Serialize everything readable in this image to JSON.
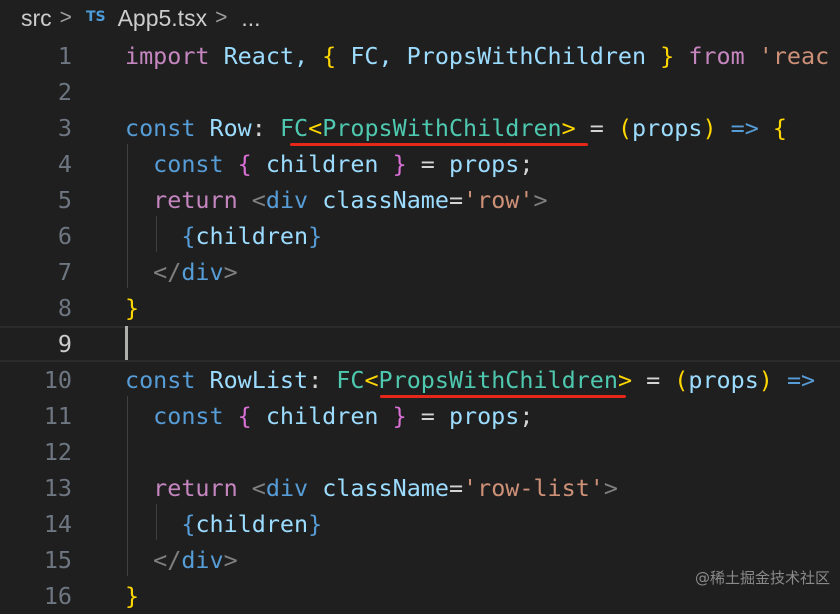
{
  "breadcrumb": {
    "folder": "src",
    "separator": ">",
    "file_badge": "TS",
    "file": "App5.tsx",
    "ellipsis": "..."
  },
  "colors": {
    "keyword": "#569cd6",
    "control": "#c586c0",
    "type": "#4ec9b0",
    "variable": "#9cdcfe",
    "function": "#dcdcaa",
    "string": "#ce9178",
    "bracket_gold": "#ffd700",
    "bracket_pink": "#da70d6",
    "bracket_blue": "#179fff",
    "tag": "#808080",
    "plain": "#d4d4d4",
    "underline": "#e8271b"
  },
  "editor": {
    "current_line": 9,
    "lines": [
      {
        "n": "1",
        "tokens": [
          [
            "import",
            "control"
          ],
          [
            " React, ",
            "variable"
          ],
          [
            "{",
            "bracket_gold"
          ],
          [
            " FC, PropsWithChildren ",
            "variable"
          ],
          [
            "}",
            "bracket_gold"
          ],
          [
            " from ",
            "control"
          ],
          [
            "'reac",
            "string"
          ]
        ]
      },
      {
        "n": "2",
        "tokens": []
      },
      {
        "n": "3",
        "tokens": [
          [
            "const",
            "keyword"
          ],
          [
            " Row",
            "variable"
          ],
          [
            ": ",
            "plain"
          ],
          [
            "FC",
            "type"
          ],
          [
            "<",
            "bracket_gold"
          ],
          [
            "PropsWithChildren",
            "type"
          ],
          [
            ">",
            "bracket_gold"
          ],
          [
            " = ",
            "plain"
          ],
          [
            "(",
            "bracket_gold"
          ],
          [
            "props",
            "variable"
          ],
          [
            ")",
            "bracket_gold"
          ],
          [
            " => ",
            "keyword"
          ],
          [
            "{",
            "bracket_gold"
          ]
        ]
      },
      {
        "n": "4",
        "tokens": [
          [
            "  const",
            "keyword"
          ],
          [
            " ",
            "plain"
          ],
          [
            "{",
            "bracket_pink"
          ],
          [
            " children ",
            "variable"
          ],
          [
            "}",
            "bracket_pink"
          ],
          [
            " = ",
            "plain"
          ],
          [
            "props",
            "variable"
          ],
          [
            ";",
            "plain"
          ]
        ]
      },
      {
        "n": "5",
        "tokens": [
          [
            "  return",
            "control"
          ],
          [
            " ",
            "plain"
          ],
          [
            "<",
            "tag"
          ],
          [
            "div",
            "keyword"
          ],
          [
            " ",
            "plain"
          ],
          [
            "className",
            "variable"
          ],
          [
            "=",
            "plain"
          ],
          [
            "'row'",
            "string"
          ],
          [
            ">",
            "tag"
          ]
        ]
      },
      {
        "n": "6",
        "tokens": [
          [
            "    ",
            "plain"
          ],
          [
            "{",
            "keyword"
          ],
          [
            "children",
            "variable"
          ],
          [
            "}",
            "keyword"
          ]
        ]
      },
      {
        "n": "7",
        "tokens": [
          [
            "  ",
            "plain"
          ],
          [
            "</",
            "tag"
          ],
          [
            "div",
            "keyword"
          ],
          [
            ">",
            "tag"
          ]
        ]
      },
      {
        "n": "8",
        "tokens": [
          [
            "}",
            "bracket_gold"
          ]
        ]
      },
      {
        "n": "9",
        "tokens": []
      },
      {
        "n": "10",
        "tokens": [
          [
            "const",
            "keyword"
          ],
          [
            " RowList",
            "variable"
          ],
          [
            ": ",
            "plain"
          ],
          [
            "FC",
            "type"
          ],
          [
            "<",
            "bracket_gold"
          ],
          [
            "PropsWithChildren",
            "type"
          ],
          [
            ">",
            "bracket_gold"
          ],
          [
            " = ",
            "plain"
          ],
          [
            "(",
            "bracket_gold"
          ],
          [
            "props",
            "variable"
          ],
          [
            ")",
            "bracket_gold"
          ],
          [
            " =>",
            "keyword"
          ]
        ]
      },
      {
        "n": "11",
        "tokens": [
          [
            "  const",
            "keyword"
          ],
          [
            " ",
            "plain"
          ],
          [
            "{",
            "bracket_pink"
          ],
          [
            " children ",
            "variable"
          ],
          [
            "}",
            "bracket_pink"
          ],
          [
            " = ",
            "plain"
          ],
          [
            "props",
            "variable"
          ],
          [
            ";",
            "plain"
          ]
        ]
      },
      {
        "n": "12",
        "tokens": []
      },
      {
        "n": "13",
        "tokens": [
          [
            "  return",
            "control"
          ],
          [
            " ",
            "plain"
          ],
          [
            "<",
            "tag"
          ],
          [
            "div",
            "keyword"
          ],
          [
            " ",
            "plain"
          ],
          [
            "className",
            "variable"
          ],
          [
            "=",
            "plain"
          ],
          [
            "'row-list'",
            "string"
          ],
          [
            ">",
            "tag"
          ]
        ]
      },
      {
        "n": "14",
        "tokens": [
          [
            "    ",
            "plain"
          ],
          [
            "{",
            "keyword"
          ],
          [
            "children",
            "variable"
          ],
          [
            "}",
            "keyword"
          ]
        ]
      },
      {
        "n": "15",
        "tokens": [
          [
            "  ",
            "plain"
          ],
          [
            "</",
            "tag"
          ],
          [
            "div",
            "keyword"
          ],
          [
            ">",
            "tag"
          ]
        ]
      },
      {
        "n": "16",
        "tokens": [
          [
            "}",
            "bracket_gold"
          ]
        ]
      }
    ]
  },
  "watermark": "@稀土掘金技术社区"
}
